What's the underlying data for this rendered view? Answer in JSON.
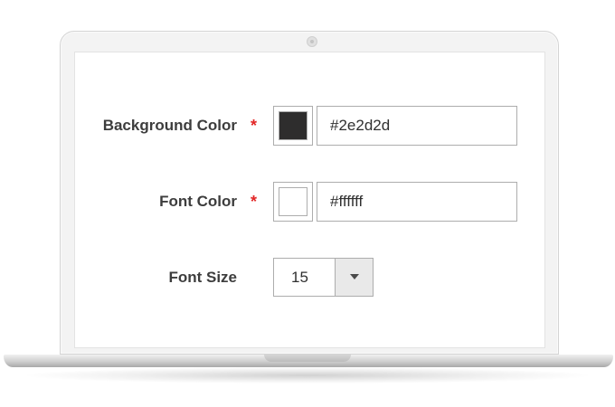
{
  "form": {
    "background_color": {
      "label": "Background Color",
      "required_mark": "*",
      "value": "#2e2d2d",
      "swatch_color": "#2e2d2d"
    },
    "font_color": {
      "label": "Font Color",
      "required_mark": "*",
      "value": "#ffffff",
      "swatch_color": "#ffffff"
    },
    "font_size": {
      "label": "Font Size",
      "selected": "15"
    }
  }
}
